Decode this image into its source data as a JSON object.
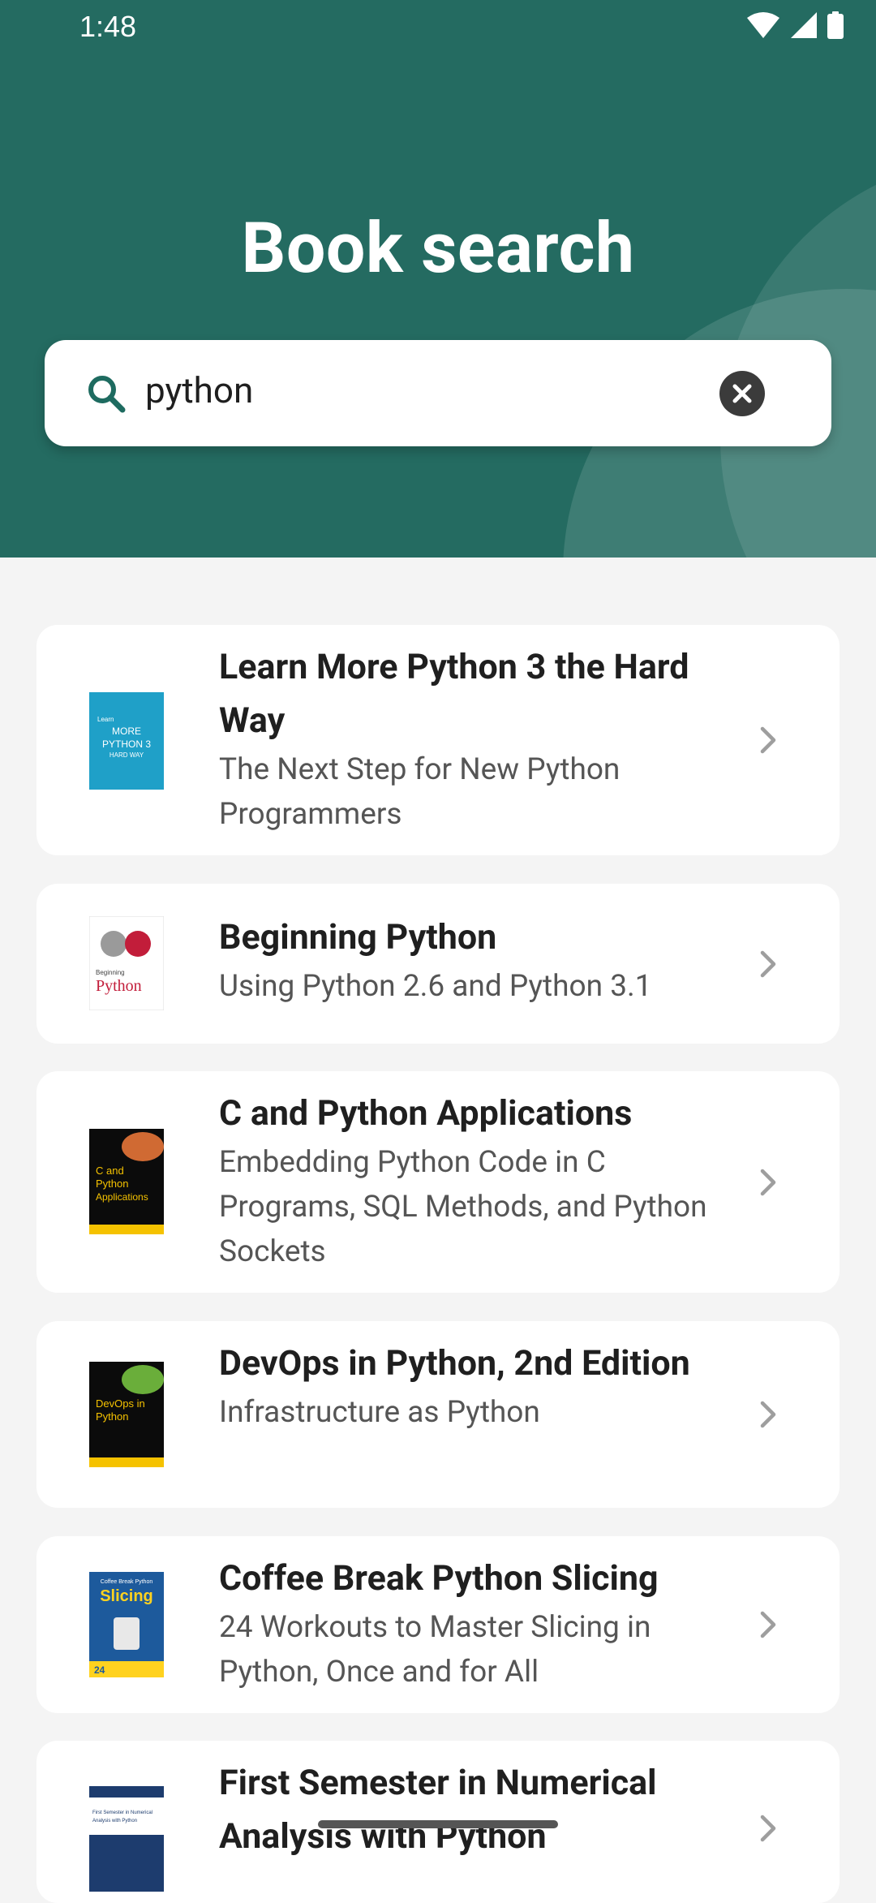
{
  "status": {
    "time": "1:48"
  },
  "header": {
    "title": "Book search"
  },
  "search": {
    "value": "python",
    "placeholder": ""
  },
  "books": [
    {
      "title": "Learn More Python 3 the Hard Way",
      "subtitle": "The Next Step for New Python Programmers",
      "cover": {
        "bg": "#1fa0c8",
        "fg": "#ffffff",
        "lines": [
          "Learn",
          "MORE",
          "PYTHON 3",
          "HARD WAY"
        ]
      }
    },
    {
      "title": "Beginning Python",
      "subtitle": "Using Python 2.6 and Python 3.1",
      "cover": {
        "bg": "#ffffff",
        "fg": "#c21d3a",
        "lines": [
          "Beginning",
          "Python"
        ]
      }
    },
    {
      "title": "C and Python Applications",
      "subtitle": "Embedding Python Code in C Programs, SQL Methods, and Python Sockets",
      "cover": {
        "bg": "#0b0b0b",
        "fg": "#f5c200",
        "lines": [
          "C and",
          "Python",
          "Applications"
        ]
      }
    },
    {
      "title": "DevOps in Python, 2nd Edition",
      "subtitle": "Infrastructure as Python",
      "cover": {
        "bg": "#0b0b0b",
        "fg": "#f5c200",
        "lines": [
          "DevOps in",
          "Python"
        ]
      }
    },
    {
      "title": "Coffee Break Python Slicing",
      "subtitle": "24 Workouts to Master Slicing in Python, Once and for All",
      "cover": {
        "bg": "#1d5a9c",
        "fg": "#ffd21f",
        "lines": [
          "Coffee Break Python",
          "Slicing",
          "24"
        ]
      }
    },
    {
      "title": "First Semester in Numerical Analysis with Python",
      "subtitle": "",
      "cover": {
        "bg": "#ffffff",
        "fg": "#1d3c6e",
        "lines": [
          "First Semester in Numerical",
          "Analysis with Python"
        ]
      }
    }
  ]
}
